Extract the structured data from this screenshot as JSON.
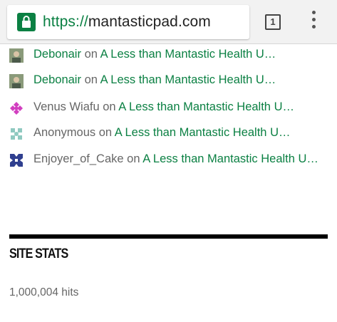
{
  "browser": {
    "url_scheme": "https://",
    "url_host": "mantasticpad.com",
    "tab_count": "1",
    "secure_color": "#0b8043"
  },
  "comments": [
    {
      "author": "Debonair",
      "on": "on",
      "post": "A Less than Mantastic Health U…",
      "author_link": true
    },
    {
      "author": "Debonair",
      "on": "on",
      "post": "A Less than Mantastic Health U…",
      "author_link": true
    },
    {
      "author": "Venus Wiafu",
      "on": "on",
      "post": "A Less than Mantastic Health U…",
      "author_link": false
    },
    {
      "author": "Anonymous",
      "on": "on",
      "post": "A Less than Mantastic Health U…",
      "author_link": false
    },
    {
      "author": "Enjoyer_of_Cake",
      "on": "on",
      "post": "A Less than Mantastic Health U…",
      "author_link": false
    }
  ],
  "site_stats": {
    "title": "SITE STATS",
    "hits": "1,000,004 hits"
  }
}
